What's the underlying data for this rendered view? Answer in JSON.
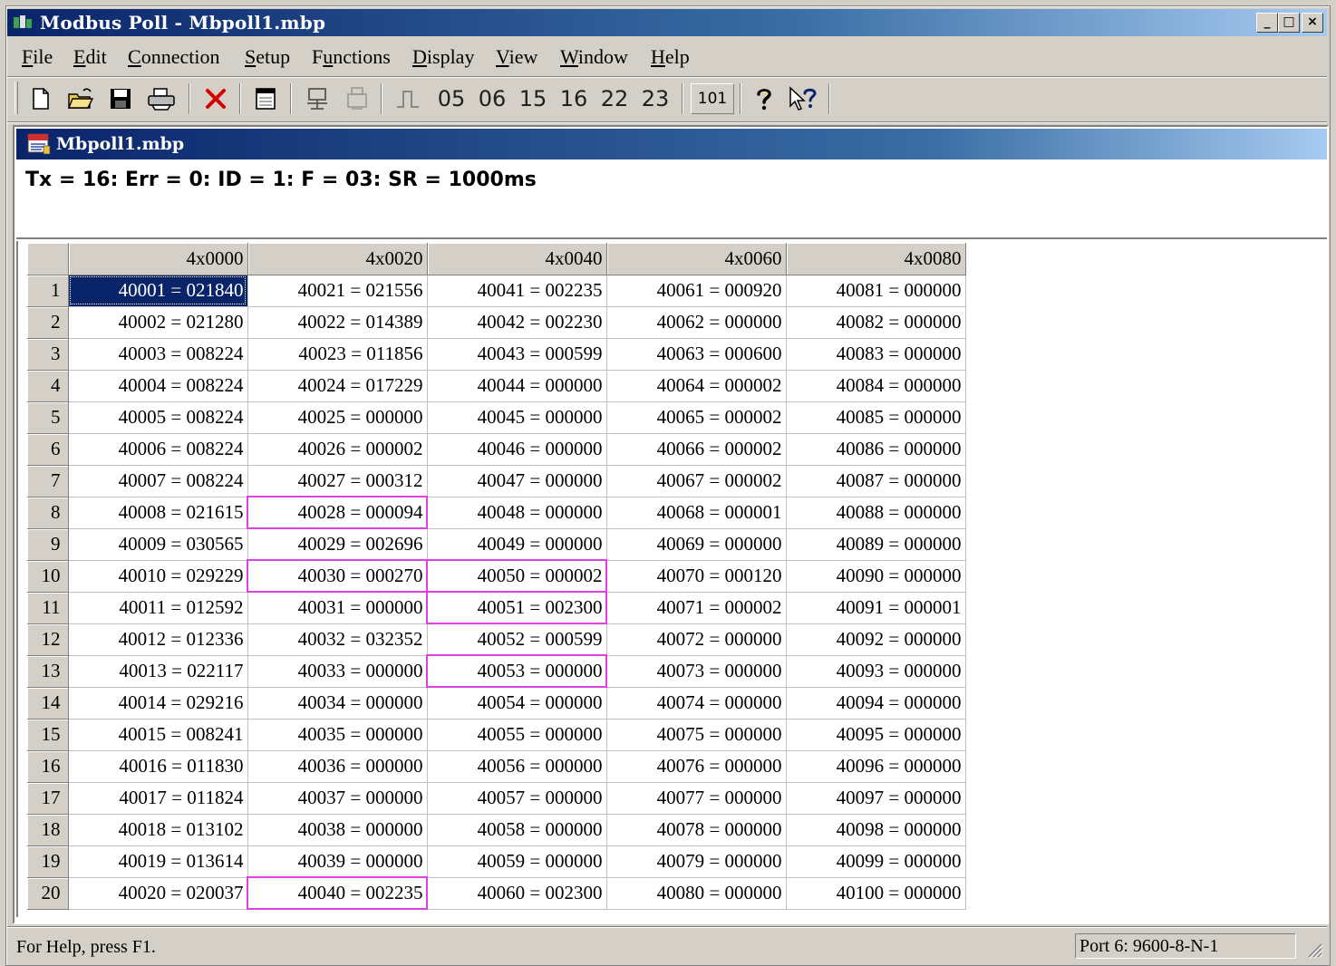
{
  "app": {
    "title": "Modbus Poll - Mbpoll1.mbp"
  },
  "window_controls": {
    "minimize": "_",
    "maximize": "□",
    "close": "×"
  },
  "menu": [
    {
      "label": "File",
      "mnemonic": "F",
      "rest": "ile"
    },
    {
      "label": "Edit",
      "mnemonic": "E",
      "rest": "dit"
    },
    {
      "label": "Connection",
      "mnemonic": "C",
      "rest": "onnection"
    },
    {
      "label": "Setup",
      "mnemonic": "S",
      "rest": "etup"
    },
    {
      "label": "Functions",
      "pre": "F",
      "mnemonic": "u",
      "rest": "nctions"
    },
    {
      "label": "Display",
      "mnemonic": "D",
      "rest": "isplay"
    },
    {
      "label": "View",
      "mnemonic": "V",
      "rest": "iew"
    },
    {
      "label": "Window",
      "mnemonic": "W",
      "rest": "indow"
    },
    {
      "label": "Help",
      "mnemonic": "H",
      "rest": "elp"
    }
  ],
  "toolbar": {
    "icons": [
      "new-file-icon",
      "open-folder-icon",
      "save-icon",
      "print-icon",
      "delete-icon",
      "window-icon",
      "connect-icon",
      "disconnect-icon",
      "pulse-icon"
    ],
    "function_codes": [
      "05",
      "06",
      "15",
      "16",
      "22",
      "23"
    ],
    "counter": "101",
    "help_icons": [
      "help-icon",
      "context-help-icon"
    ]
  },
  "document": {
    "title": "Mbpoll1.mbp",
    "status_line": "Tx = 16: Err = 0: ID = 1: F = 03: SR = 1000ms"
  },
  "grid": {
    "columns": [
      "4x0000",
      "4x0020",
      "4x0040",
      "4x0060",
      "4x0080"
    ],
    "rows": [
      [
        "40001 = 021840",
        "40021 = 021556",
        "40041 = 002235",
        "40061 = 000920",
        "40081 = 000000"
      ],
      [
        "40002 = 021280",
        "40022 = 014389",
        "40042 = 002230",
        "40062 = 000000",
        "40082 = 000000"
      ],
      [
        "40003 = 008224",
        "40023 = 011856",
        "40043 = 000599",
        "40063 = 000600",
        "40083 = 000000"
      ],
      [
        "40004 = 008224",
        "40024 = 017229",
        "40044 = 000000",
        "40064 = 000002",
        "40084 = 000000"
      ],
      [
        "40005 = 008224",
        "40025 = 000000",
        "40045 = 000000",
        "40065 = 000002",
        "40085 = 000000"
      ],
      [
        "40006 = 008224",
        "40026 = 000002",
        "40046 = 000000",
        "40066 = 000002",
        "40086 = 000000"
      ],
      [
        "40007 = 008224",
        "40027 = 000312",
        "40047 = 000000",
        "40067 = 000002",
        "40087 = 000000"
      ],
      [
        "40008 = 021615",
        "40028 = 000094",
        "40048 = 000000",
        "40068 = 000001",
        "40088 = 000000"
      ],
      [
        "40009 = 030565",
        "40029 = 002696",
        "40049 = 000000",
        "40069 = 000000",
        "40089 = 000000"
      ],
      [
        "40010 = 029229",
        "40030 = 000270",
        "40050 = 000002",
        "40070 = 000120",
        "40090 = 000000"
      ],
      [
        "40011 = 012592",
        "40031 = 000000",
        "40051 = 002300",
        "40071 = 000002",
        "40091 = 000001"
      ],
      [
        "40012 = 012336",
        "40032 = 032352",
        "40052 = 000599",
        "40072 = 000000",
        "40092 = 000000"
      ],
      [
        "40013 = 022117",
        "40033 = 000000",
        "40053 = 000000",
        "40073 = 000000",
        "40093 = 000000"
      ],
      [
        "40014 = 029216",
        "40034 = 000000",
        "40054 = 000000",
        "40074 = 000000",
        "40094 = 000000"
      ],
      [
        "40015 = 008241",
        "40035 = 000000",
        "40055 = 000000",
        "40075 = 000000",
        "40095 = 000000"
      ],
      [
        "40016 = 011830",
        "40036 = 000000",
        "40056 = 000000",
        "40076 = 000000",
        "40096 = 000000"
      ],
      [
        "40017 = 011824",
        "40037 = 000000",
        "40057 = 000000",
        "40077 = 000000",
        "40097 = 000000"
      ],
      [
        "40018 = 013102",
        "40038 = 000000",
        "40058 = 000000",
        "40078 = 000000",
        "40098 = 000000"
      ],
      [
        "40019 = 013614",
        "40039 = 000000",
        "40059 = 000000",
        "40079 = 000000",
        "40099 = 000000"
      ],
      [
        "40020 = 020037",
        "40040 = 002235",
        "40060 = 002300",
        "40080 = 000000",
        "40100 = 000000"
      ]
    ],
    "selected": {
      "row": 1,
      "col": 1
    },
    "highlighted": [
      {
        "row": 8,
        "col": 2
      },
      {
        "row": 10,
        "col": 2
      },
      {
        "row": 10,
        "col": 3
      },
      {
        "row": 11,
        "col": 3
      },
      {
        "row": 13,
        "col": 3
      },
      {
        "row": 20,
        "col": 2
      }
    ],
    "highlight_color": "#e040e0",
    "selection_color": "#0a246a"
  },
  "statusbar": {
    "help": "For Help, press F1.",
    "port": "Port 6: 9600-8-N-1"
  },
  "colors": {
    "titlebar": "#0a246a",
    "face": "#d4d0c8"
  }
}
